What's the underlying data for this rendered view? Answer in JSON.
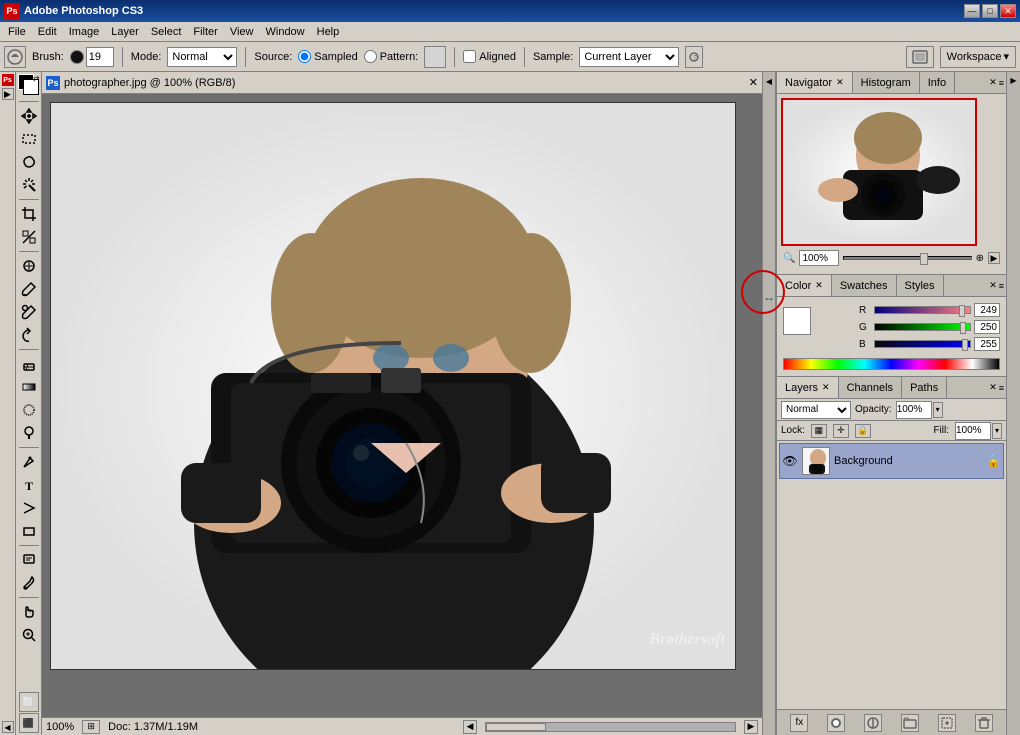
{
  "app": {
    "title": "Adobe Photoshop CS3",
    "icon": "PS"
  },
  "titlebar": {
    "title": "Adobe Photoshop CS3",
    "min_btn": "—",
    "max_btn": "□",
    "close_btn": "✕"
  },
  "menubar": {
    "items": [
      "File",
      "Edit",
      "Image",
      "Layer",
      "Select",
      "Filter",
      "View",
      "Window",
      "Help"
    ]
  },
  "optionsbar": {
    "brush_label": "Brush:",
    "brush_size": "19",
    "mode_label": "Mode:",
    "mode_value": "Normal",
    "source_label": "Source:",
    "sampled_label": "Sampled",
    "pattern_label": "Pattern:",
    "aligned_label": "Aligned",
    "sample_label": "Sample:",
    "sample_value": "Current Layer"
  },
  "canvas": {
    "tab_title": "photographer.jpg @ 100% (RGB/8)",
    "zoom": "100%",
    "doc_info": "Doc: 1.37M/1.19M"
  },
  "navigator": {
    "tab_label": "Navigator",
    "histogram_tab": "Histogram",
    "info_tab": "Info",
    "zoom_value": "100%"
  },
  "color": {
    "tab_label": "Color",
    "swatches_tab": "Swatches",
    "styles_tab": "Styles",
    "r_label": "R",
    "g_label": "G",
    "b_label": "B",
    "r_value": "249",
    "g_value": "250",
    "b_value": "255"
  },
  "layers": {
    "tab_label": "Layers",
    "channels_tab": "Channels",
    "paths_tab": "Paths",
    "blend_mode": "Normal",
    "opacity_label": "Opacity:",
    "opacity_value": "100%",
    "lock_label": "Lock:",
    "fill_label": "Fill:",
    "fill_value": "100%",
    "layer_name": "Background"
  },
  "workspace": {
    "label": "Workspace",
    "dropdown_icon": "▾"
  },
  "tools": [
    {
      "name": "move",
      "icon": "⊹",
      "label": "Move Tool"
    },
    {
      "name": "marquee",
      "icon": "⬚",
      "label": "Marquee Tool"
    },
    {
      "name": "lasso",
      "icon": "⌖",
      "label": "Lasso Tool"
    },
    {
      "name": "magic-wand",
      "icon": "✦",
      "label": "Magic Wand"
    },
    {
      "name": "crop",
      "icon": "⊡",
      "label": "Crop Tool"
    },
    {
      "name": "slice",
      "icon": "⊿",
      "label": "Slice Tool"
    },
    {
      "name": "healing",
      "icon": "✚",
      "label": "Healing Brush"
    },
    {
      "name": "brush",
      "icon": "✏",
      "label": "Brush Tool"
    },
    {
      "name": "clone",
      "icon": "⊕",
      "label": "Clone Stamp"
    },
    {
      "name": "history",
      "icon": "↺",
      "label": "History Brush"
    },
    {
      "name": "eraser",
      "icon": "◻",
      "label": "Eraser"
    },
    {
      "name": "gradient",
      "icon": "▦",
      "label": "Gradient"
    },
    {
      "name": "blur",
      "icon": "◌",
      "label": "Blur"
    },
    {
      "name": "dodge",
      "icon": "○",
      "label": "Dodge"
    },
    {
      "name": "pen",
      "icon": "✒",
      "label": "Pen Tool"
    },
    {
      "name": "type",
      "icon": "T",
      "label": "Type Tool"
    },
    {
      "name": "path-select",
      "icon": "↖",
      "label": "Path Select"
    },
    {
      "name": "shape",
      "icon": "▭",
      "label": "Shape Tool"
    },
    {
      "name": "notes",
      "icon": "✉",
      "label": "Notes Tool"
    },
    {
      "name": "eyedropper",
      "icon": "⊘",
      "label": "Eyedropper"
    },
    {
      "name": "hand",
      "icon": "✋",
      "label": "Hand Tool"
    },
    {
      "name": "zoom",
      "icon": "⊕",
      "label": "Zoom Tool"
    }
  ],
  "watermark": "Br thersøft"
}
